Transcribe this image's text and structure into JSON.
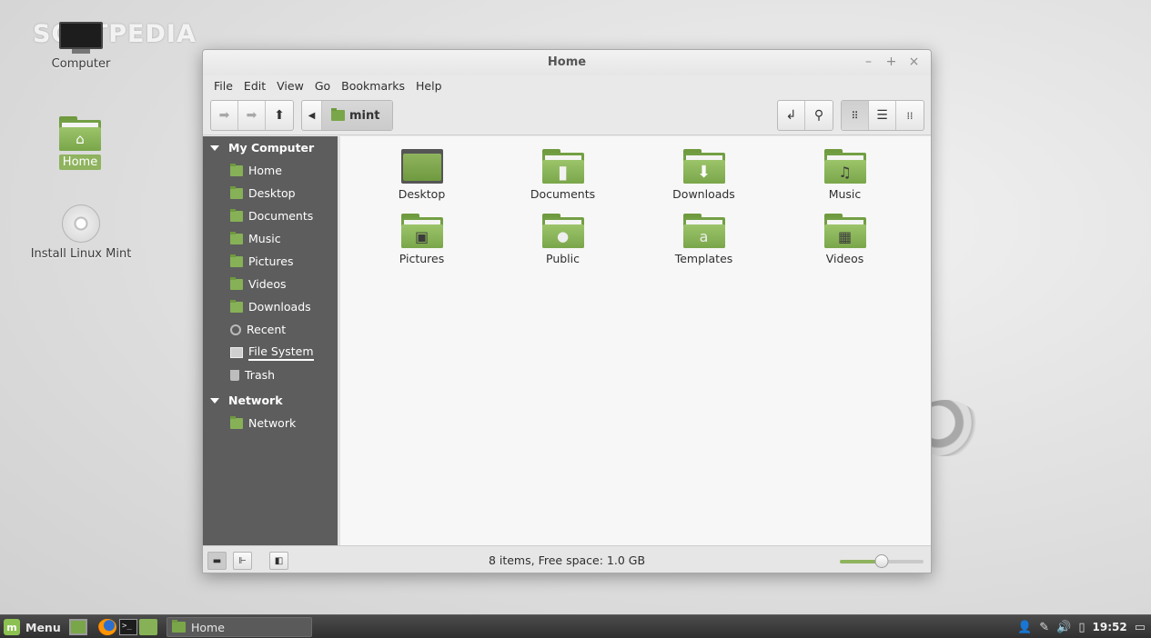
{
  "watermark": "SOFTPEDIA",
  "desktop": {
    "icons": [
      {
        "label": "Computer"
      },
      {
        "label": "Home"
      },
      {
        "label": "Install Linux Mint"
      }
    ]
  },
  "window": {
    "title": "Home",
    "controls": {
      "minimize": "–",
      "maximize": "+",
      "close": "×"
    },
    "menu": [
      "File",
      "Edit",
      "View",
      "Go",
      "Bookmarks",
      "Help"
    ],
    "toolbar": {
      "back_icon": "arrow-left",
      "forward_icon": "arrow-right",
      "up_icon": "arrow-up",
      "breadcrumb_toggle_icon": "triangle-left",
      "location": "mint",
      "toggle_location_icon": "toggle-location",
      "search_icon": "search",
      "views": [
        "icon-view",
        "list-view",
        "compact-view"
      ],
      "active_view": "icon-view"
    },
    "sidebar": {
      "sections": [
        {
          "title": "My Computer",
          "items": [
            {
              "label": "Home",
              "icon": "home-folder"
            },
            {
              "label": "Desktop",
              "icon": "desktop-folder"
            },
            {
              "label": "Documents",
              "icon": "folder"
            },
            {
              "label": "Music",
              "icon": "folder"
            },
            {
              "label": "Pictures",
              "icon": "folder"
            },
            {
              "label": "Videos",
              "icon": "folder"
            },
            {
              "label": "Downloads",
              "icon": "folder"
            },
            {
              "label": "Recent",
              "icon": "clock"
            },
            {
              "label": "File System",
              "icon": "drive"
            },
            {
              "label": "Trash",
              "icon": "trash"
            }
          ]
        },
        {
          "title": "Network",
          "items": [
            {
              "label": "Network",
              "icon": "network-folder"
            }
          ]
        }
      ]
    },
    "files": [
      {
        "name": "Desktop",
        "glyph": ""
      },
      {
        "name": "Documents",
        "glyph": "▯"
      },
      {
        "name": "Downloads",
        "glyph": "⬇"
      },
      {
        "name": "Music",
        "glyph": "♫"
      },
      {
        "name": "Pictures",
        "glyph": "▣"
      },
      {
        "name": "Public",
        "glyph": "👤"
      },
      {
        "name": "Templates",
        "glyph": "a"
      },
      {
        "name": "Videos",
        "glyph": "▦"
      }
    ],
    "status": "8 items, Free space: 1.0 GB",
    "zoom_level": 0.5
  },
  "taskbar": {
    "menu_label": "Menu",
    "task_label": "Home",
    "clock": "19:52",
    "tray_icons": [
      "user-icon",
      "network-icon",
      "volume-icon",
      "battery-icon",
      "display-icon"
    ]
  }
}
